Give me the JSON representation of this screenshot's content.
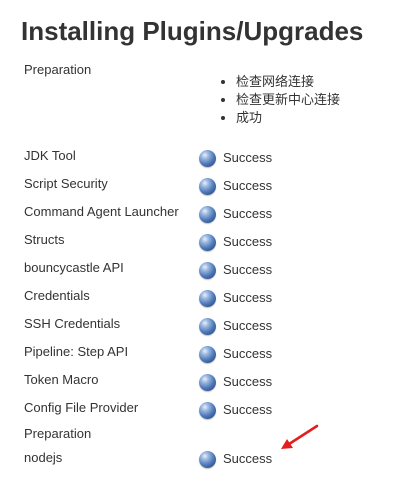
{
  "page": {
    "title": "Installing Plugins/Upgrades"
  },
  "preparation": {
    "label": "Preparation",
    "steps": [
      "检查网络连接",
      "检查更新中心连接",
      "成功"
    ]
  },
  "plugins": [
    {
      "name": "JDK Tool",
      "status": "Success"
    },
    {
      "name": "Script Security",
      "status": "Success"
    },
    {
      "name": "Command Agent Launcher",
      "status": "Success"
    },
    {
      "name": "Structs",
      "status": "Success"
    },
    {
      "name": "bouncycastle API",
      "status": "Success"
    },
    {
      "name": "Credentials",
      "status": "Success"
    },
    {
      "name": "SSH Credentials",
      "status": "Success"
    },
    {
      "name": "Pipeline: Step API",
      "status": "Success"
    },
    {
      "name": "Token Macro",
      "status": "Success"
    },
    {
      "name": "Config File Provider",
      "status": "Success"
    }
  ],
  "preparation2": {
    "label": "Preparation"
  },
  "final_plugin": {
    "name": "nodejs",
    "status": "Success"
  },
  "colors": {
    "text": "#333333",
    "status_ball": "#4f79b8",
    "arrow": "#e02020"
  },
  "icons": {
    "status": "blue-ball-icon",
    "annotation": "red-arrow-icon"
  }
}
